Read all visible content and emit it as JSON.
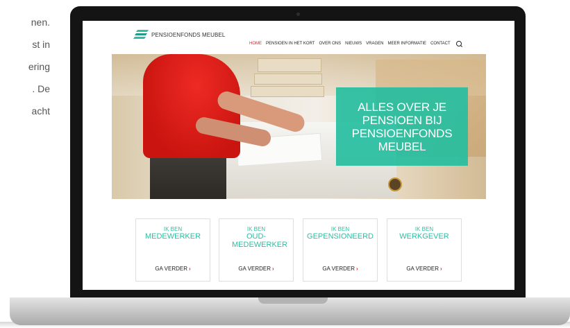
{
  "side_text": {
    "lines": [
      "nen.",
      "st in",
      "ering",
      ". De",
      "acht"
    ]
  },
  "site": {
    "logo_text": "PENSIOENFONDS MEUBEL",
    "nav": [
      "HOME",
      "PENSIOEN IN HET KORT",
      "OVER ONS",
      "NIEUWS",
      "VRAGEN",
      "MEER INFORMATIE",
      "CONTACT"
    ],
    "active_nav": "HOME",
    "hero_title": "ALLES OVER JE PENSIOEN BIJ PENSIOENFONDS MEUBEL",
    "cards": [
      {
        "pre": "IK BEN",
        "title": "MEDEWERKER",
        "cta": "GA VERDER"
      },
      {
        "pre": "IK BEN",
        "title": "OUD-MEDEWERKER",
        "cta": "GA VERDER"
      },
      {
        "pre": "IK BEN",
        "title": "GEPENSIONEERD",
        "cta": "GA VERDER"
      },
      {
        "pre": "IK BEN",
        "title": "WERKGEVER",
        "cta": "GA VERDER"
      }
    ]
  },
  "colors": {
    "accent_teal": "#2bbfa4",
    "accent_red": "#d2252f"
  },
  "icons": {
    "search": "search-icon",
    "chevron": "chevron-right-icon"
  }
}
